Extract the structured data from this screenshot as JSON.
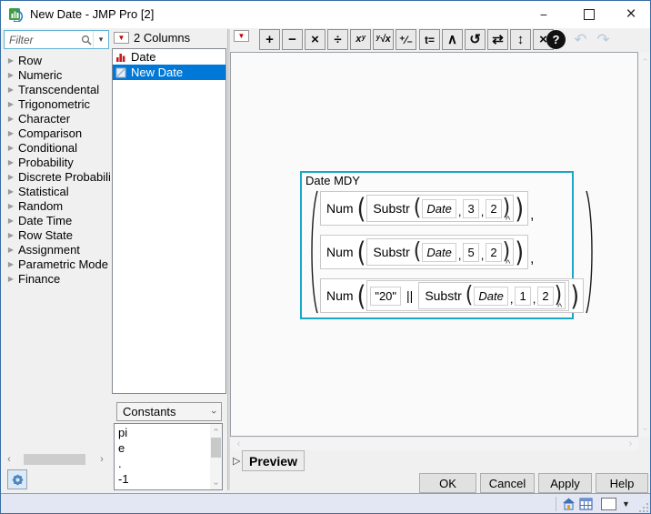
{
  "window": {
    "title": "New Date - JMP Pro [2]"
  },
  "window_controls": {
    "minimize": "−",
    "close": "×"
  },
  "filter": {
    "placeholder": "Filter",
    "dropdown_glyph": "▾"
  },
  "functions": {
    "expander_glyph": "▶",
    "items": [
      "Row",
      "Numeric",
      "Transcendental",
      "Trigonometric",
      "Character",
      "Comparison",
      "Conditional",
      "Probability",
      "Discrete Probabili",
      "Statistical",
      "Random",
      "Date Time",
      "Row State",
      "Assignment",
      "Parametric Mode",
      "Finance"
    ]
  },
  "columns_panel": {
    "menu_glyph": "▼",
    "header": "2 Columns",
    "items": [
      {
        "label": "Date",
        "icon": "histogram-icon",
        "selected": false
      },
      {
        "label": "New Date",
        "icon": "no-modeling-type-icon",
        "selected": true
      }
    ]
  },
  "constants_panel": {
    "selected": "Constants",
    "items": [
      "pi",
      "e",
      ".",
      "-1"
    ]
  },
  "toolbar": {
    "menu_glyph": "▼",
    "buttons": [
      {
        "name": "add",
        "glyph": "+"
      },
      {
        "name": "subtract",
        "glyph": "−"
      },
      {
        "name": "multiply",
        "glyph": "×"
      },
      {
        "name": "divide",
        "glyph": "÷"
      },
      {
        "name": "power",
        "glyph": "xʸ"
      },
      {
        "name": "root",
        "glyph": "ʸ√x"
      },
      {
        "name": "unary-sign",
        "glyph": "⁺⁄₋"
      },
      {
        "name": "local-variable",
        "glyph": "t="
      },
      {
        "name": "peel-expression",
        "glyph": "∧"
      },
      {
        "name": "dynamic-reference",
        "glyph": "↺"
      },
      {
        "name": "swap-terms",
        "glyph": "⇄"
      },
      {
        "name": "invert-expression",
        "glyph": "↕"
      },
      {
        "name": "delete-expression",
        "glyph": "×"
      },
      {
        "name": "help",
        "glyph": "?"
      },
      {
        "name": "undo",
        "glyph": "↶"
      },
      {
        "name": "redo",
        "glyph": "↷"
      }
    ]
  },
  "formula": {
    "title": "Date MDY",
    "open": "(",
    "close": ")",
    "comma": ",",
    "caret": "^",
    "rows": [
      {
        "fn": "Num",
        "inner": {
          "fn": "Substr",
          "arg0": "Date",
          "arg1": "3",
          "arg2": "2"
        },
        "tail": ","
      },
      {
        "fn": "Num",
        "inner": {
          "fn": "Substr",
          "arg0": "Date",
          "arg1": "5",
          "arg2": "2"
        },
        "tail": ","
      },
      {
        "fn": "Num",
        "str": "\"20\"",
        "concat": "||",
        "inner": {
          "fn": "Substr",
          "arg0": "Date",
          "arg1": "1",
          "arg2": "2"
        },
        "tail": ""
      }
    ]
  },
  "preview": {
    "label": "Preview",
    "expander_glyph": "▷"
  },
  "dialog": {
    "ok": "OK",
    "cancel": "Cancel",
    "apply": "Apply",
    "help": "Help"
  },
  "scroll": {
    "left": "‹",
    "right": "›",
    "chevron": "›"
  }
}
